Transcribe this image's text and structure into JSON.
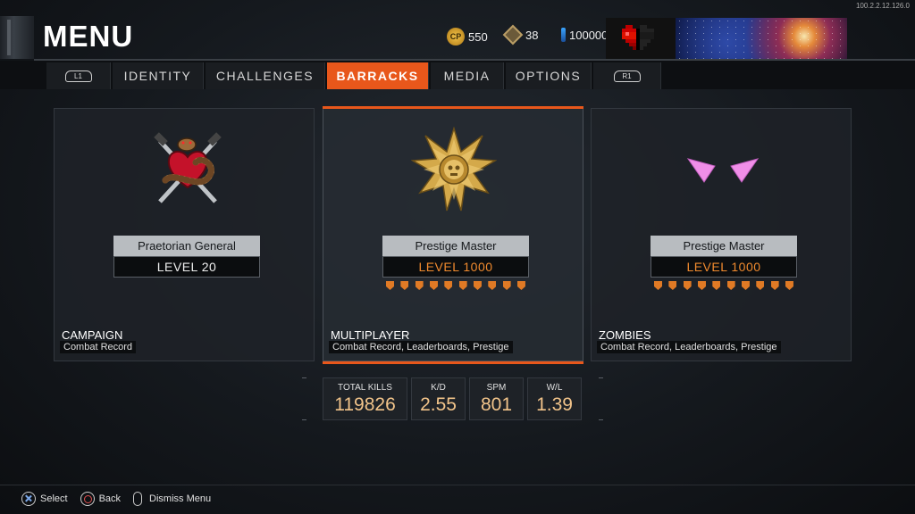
{
  "version": "100.2.2.12.126.0",
  "header": {
    "title": "MENU"
  },
  "currencies": [
    {
      "icon": "cp-icon",
      "label": "CP",
      "value": "550"
    },
    {
      "icon": "cryptokey-icon",
      "value": "38"
    },
    {
      "icon": "vial-icon",
      "value": "100000"
    }
  ],
  "tabs": {
    "left_bumper": "L1",
    "right_bumper": "R1",
    "items": [
      {
        "label": "IDENTITY",
        "active": false
      },
      {
        "label": "CHALLENGES",
        "active": false
      },
      {
        "label": "BARRACKS",
        "active": true
      },
      {
        "label": "MEDIA",
        "active": false
      },
      {
        "label": "OPTIONS",
        "active": false
      }
    ]
  },
  "cards": [
    {
      "mode": "CAMPAIGN",
      "subtitle": "Combat Record",
      "rank": "Praetorian General",
      "level": "LEVEL 20",
      "emblem": "snake-heart-daggers-icon",
      "prestige_pips": 0,
      "selected": false
    },
    {
      "mode": "MULTIPLAYER",
      "subtitle": "Combat Record, Leaderboards, Prestige",
      "rank": "Prestige Master",
      "level": "LEVEL 1000",
      "emblem": "gold-star-skull-icon",
      "prestige_pips": 10,
      "selected": true
    },
    {
      "mode": "ZOMBIES",
      "subtitle": "Combat Record, Leaderboards, Prestige",
      "rank": "Prestige Master",
      "level": "LEVEL 1000",
      "emblem": "pink-eyes-icon",
      "prestige_pips": 10,
      "selected": false
    }
  ],
  "stats": [
    {
      "label": "TOTAL KILLS",
      "value": "119826"
    },
    {
      "label": "K/D",
      "value": "2.55"
    },
    {
      "label": "SPM",
      "value": "801"
    },
    {
      "label": "W/L",
      "value": "1.39"
    }
  ],
  "footer": {
    "select": "Select",
    "back": "Back",
    "dismiss": "Dismiss Menu"
  },
  "colors": {
    "accent": "#e8571b",
    "level_orange": "#f08a2e",
    "stat_value": "#f2c48a"
  }
}
